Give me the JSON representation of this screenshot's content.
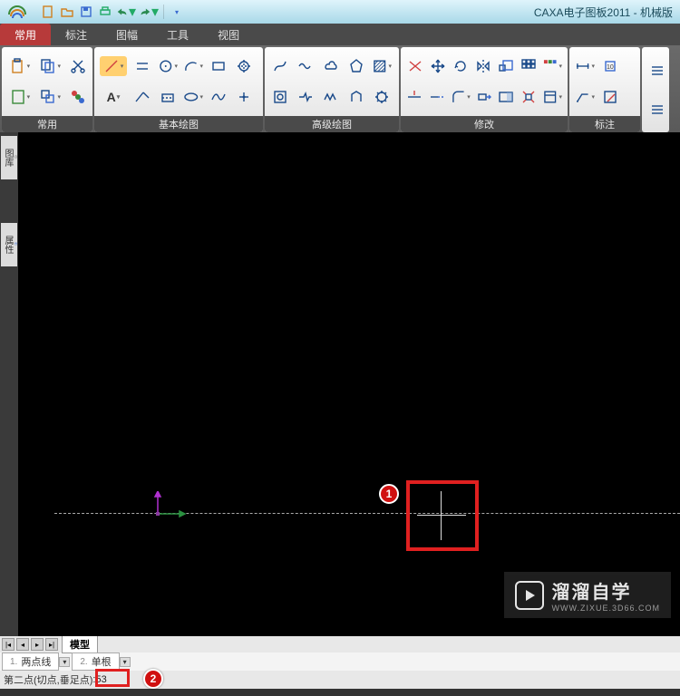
{
  "app": {
    "title": "CAXA电子图板2011 - 机械版"
  },
  "ribbon": {
    "tabs": [
      "常用",
      "标注",
      "图幅",
      "工具",
      "视图"
    ],
    "panels": {
      "changyong": "常用",
      "jibenhuitu": "基本绘图",
      "gaojihuitu": "高级绘图",
      "xiugai": "修改",
      "biaozhu": "标注"
    }
  },
  "side": {
    "tab1": "图库",
    "tab2": "属性"
  },
  "annotation": {
    "one": "1",
    "two": "2"
  },
  "modelbar": {
    "tab": "模型"
  },
  "options": {
    "opt1_num": "1.",
    "opt1": "两点线",
    "opt2_num": "2.",
    "opt2": "单根"
  },
  "command": {
    "prompt": "第二点(切点,垂足点)",
    "value": ":53"
  },
  "watermark": {
    "text": "溜溜自学",
    "sub": "WWW.ZIXUE.3D66.COM"
  }
}
